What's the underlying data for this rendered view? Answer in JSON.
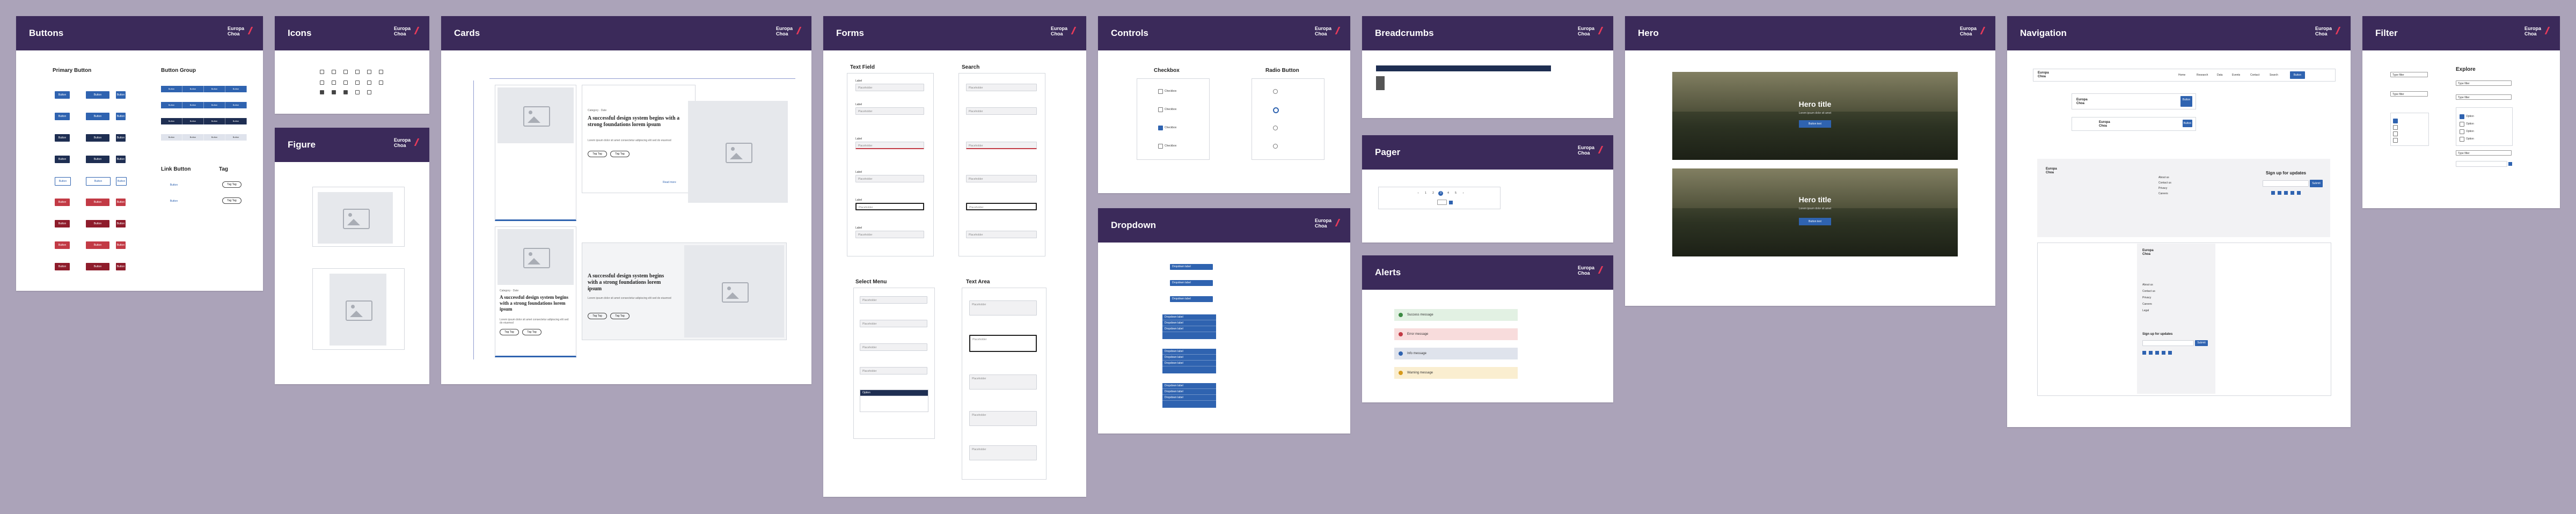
{
  "brand": {
    "line1": "Europa",
    "line2": "Choa",
    "accent": "#e63a5a",
    "header_bg": "#3b2a5a",
    "primary": "#2f63b0"
  },
  "boards": {
    "buttons": {
      "title": "Buttons"
    },
    "icons": {
      "title": "Icons"
    },
    "figure": {
      "title": "Figure"
    },
    "cards": {
      "title": "Cards"
    },
    "forms": {
      "title": "Forms"
    },
    "controls": {
      "title": "Controls"
    },
    "dropdown": {
      "title": "Dropdown"
    },
    "breadcrumbs": {
      "title": "Breadcrumbs"
    },
    "pager": {
      "title": "Pager"
    },
    "alerts": {
      "title": "Alerts"
    },
    "hero": {
      "title": "Hero"
    },
    "navigation": {
      "title": "Navigation"
    },
    "filter": {
      "title": "Filter"
    }
  },
  "buttons": {
    "primary_heading": "Primary Button",
    "group_heading": "Button Group",
    "link_heading": "Link Button",
    "tag_heading": "Tag",
    "label": "Button",
    "group_items": [
      "Button",
      "Button",
      "Button",
      "Button"
    ],
    "tag_label": "Tag Tag"
  },
  "cards": {
    "headline": "A successful design system begins with a strong foundations lorem ipsum",
    "kicker": "Category · Date",
    "body": "Lorem ipsum dolor sit amet consectetur adipiscing elit sed do eiusmod",
    "tag_a": "Tag Tag",
    "tag_b": "Tag Tag",
    "link": "Read more"
  },
  "forms": {
    "text_field": "Text Field",
    "search": "Search",
    "select_menu": "Select Menu",
    "text_area": "Text Area",
    "field_label": "Label",
    "placeholder": "Placeholder"
  },
  "controls": {
    "checkbox": "Checkbox",
    "radio": "Radio Button",
    "option": "Checkbox"
  },
  "dropdown": {
    "label": "Dropdown label",
    "items": [
      "Dropdown label",
      "Dropdown label",
      "Dropdown label"
    ]
  },
  "alerts": {
    "items": [
      "Success message",
      "Error message",
      "Info message",
      "Warning message"
    ]
  },
  "hero": {
    "title_1": "Hero title",
    "title_2": "Hero title",
    "subtitle": "Lorem ipsum dolor sit amet",
    "cta": "Button text"
  },
  "navigation": {
    "items": [
      "Home",
      "Research",
      "Data",
      "Events",
      "Contact",
      "Search"
    ],
    "cta": "Button",
    "signup": "Sign up for updates",
    "signup_btn": "Submit",
    "footer_links": [
      "About us",
      "Contact us",
      "Privacy",
      "Careers",
      "Legal"
    ]
  },
  "filter": {
    "heading": "Explore",
    "label": "Type filter",
    "options": [
      "Option",
      "Option",
      "Option",
      "Option"
    ]
  }
}
